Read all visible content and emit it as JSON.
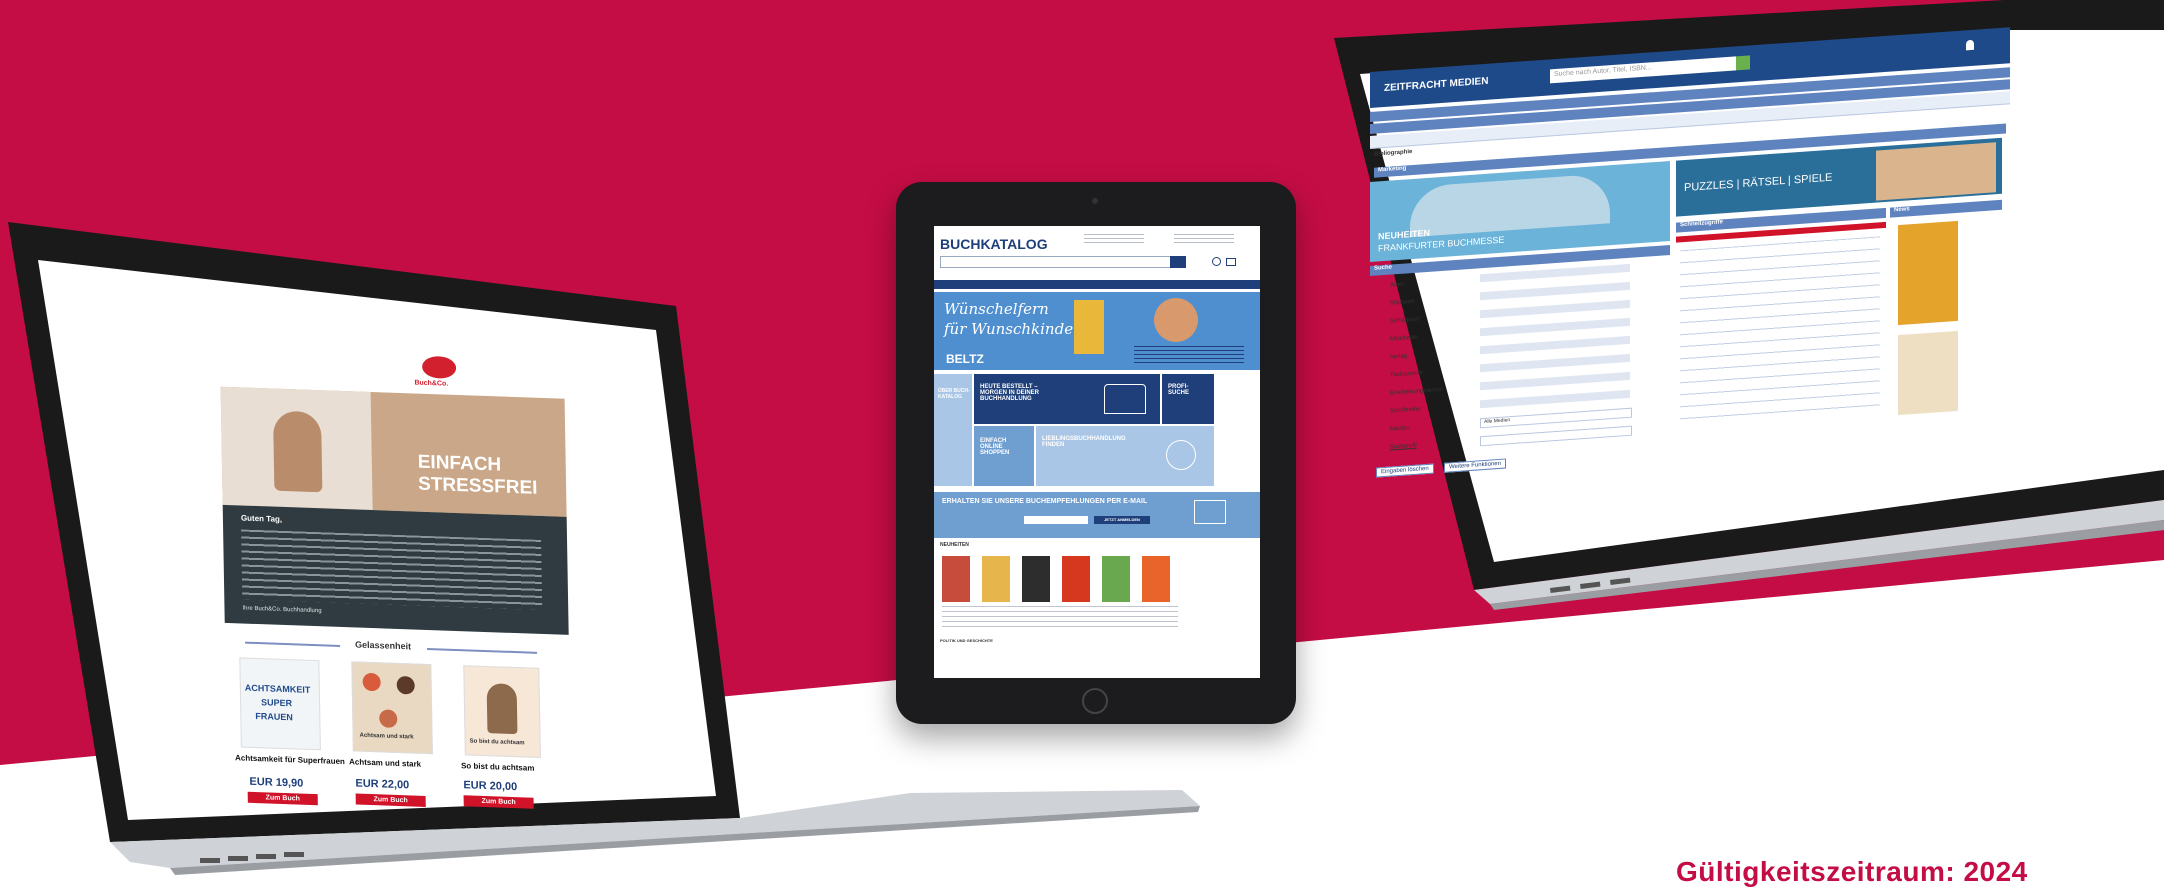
{
  "footer": {
    "validity": "Gültigkeitszeitraum: 2024"
  },
  "colors": {
    "brand_red": "#c40d44",
    "navy": "#1e3f7a",
    "tile_blue": "#6f9ed1",
    "button_red": "#d1132a"
  },
  "laptop_left": {
    "logo": "Buch&Co.",
    "hero_title": [
      "EINFACH",
      "STRESSFREI"
    ],
    "greeting": "Guten Tag,",
    "signature": "Ihre Buch&Co. Buchhandlung",
    "section_title": "Gelassenheit",
    "products": [
      {
        "title": "Achtsamkeit für Superfrauen",
        "price": "EUR 19,90",
        "button": "Zum Buch"
      },
      {
        "title": "Achtsam und stark",
        "price": "EUR 22,00",
        "button": "Zum Buch"
      },
      {
        "title": "So bist du achtsam",
        "price": "EUR 20,00",
        "button": "Zum Buch"
      }
    ],
    "cover_texts": [
      "ACHTSAMKEIT",
      "SUPER",
      "FRAUEN",
      "Achtsam und stark",
      "So bist du achtsam"
    ]
  },
  "tablet": {
    "logo": "BUCHKATALOG",
    "banner_script": [
      "Wünschelfern",
      "für Wunschkinder"
    ],
    "banner_brand": "BELTZ",
    "tiles": {
      "catalog": "ÜBER BUCH- KATALOG",
      "ordered": "HEUTE BESTELLT – MORGEN IN DEINER BUCHHANDLUNG",
      "profi": "PROFI- SUCHE",
      "shop": "EINFACH ONLINE SHOPPEN",
      "find": "LIEBLINGSBUCHHANDLUNG FINDEN"
    },
    "newsletter": "ERHALTEN SIE UNSERE BUCHEMPFEHLUNGEN PER E-MAIL",
    "newsletter_button": "JETZT ANMELDEN",
    "novelties": "NEUHEITEN",
    "bottom_section": "POLITIK UND GESCHICHTE"
  },
  "laptop_right": {
    "logo": "ZEITFRACHT MEDIEN",
    "search_placeholder": "Suche nach Autor, Titel, ISBN...",
    "breadcrumb": "Bibliographie",
    "subheading": "Marketing",
    "banner_1": [
      "NEUHEITEN",
      "FRANKFURTER BUCHMESSE"
    ],
    "banner_2": "PUZZLES | RÄTSEL | SPIELE",
    "search_panel_title": "Suche",
    "fields": [
      "Autor",
      "Stichwort",
      "Schlagwort",
      "Mitarbeiter",
      "Verlag",
      "Titelnummer",
      "Erscheinungstermin",
      "Schriftreihe",
      "Medien",
      "Suchprofil"
    ],
    "media_value": "Alle Medien",
    "shortcuts_title": "Schnellzugriffe",
    "news_title": "News",
    "buttons": [
      "Eingaben löschen",
      "Weitere Funktionen"
    ]
  }
}
